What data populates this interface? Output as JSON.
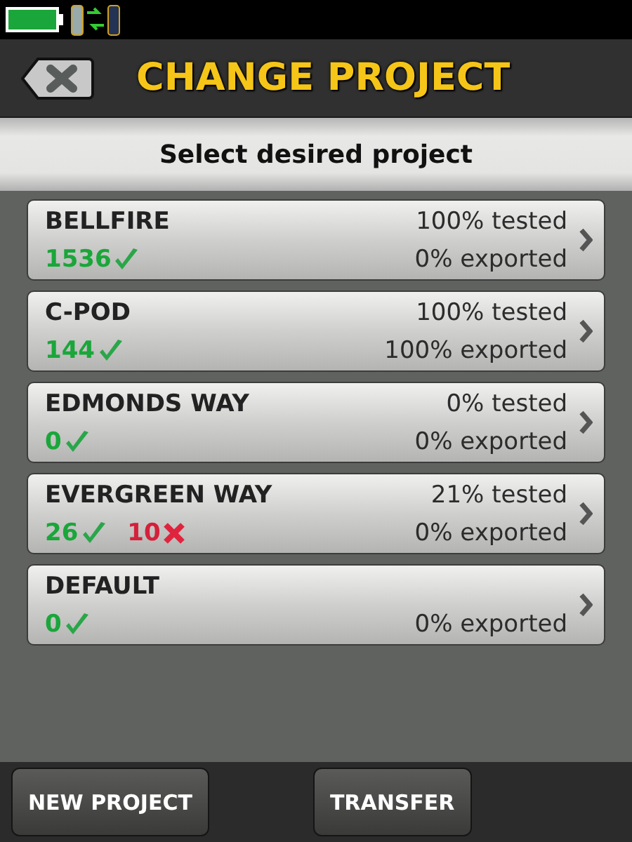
{
  "header": {
    "title": "CHANGE PROJECT"
  },
  "subtitle": "Select desired project",
  "projects": [
    {
      "name": "BELLFIRE",
      "tested": "100% tested",
      "exported": "0% exported",
      "counts": [
        {
          "kind": "pass",
          "value": "1536"
        }
      ]
    },
    {
      "name": "C-POD",
      "tested": "100% tested",
      "exported": "100% exported",
      "counts": [
        {
          "kind": "pass",
          "value": "144"
        }
      ]
    },
    {
      "name": "EDMONDS WAY",
      "tested": "0% tested",
      "exported": "0% exported",
      "counts": [
        {
          "kind": "pass",
          "value": "0"
        }
      ]
    },
    {
      "name": "EVERGREEN WAY",
      "tested": "21% tested",
      "exported": "0% exported",
      "counts": [
        {
          "kind": "pass",
          "value": "26"
        },
        {
          "kind": "fail",
          "value": "10"
        }
      ]
    },
    {
      "name": "DEFAULT",
      "exported": "0% exported",
      "counts": [
        {
          "kind": "pass",
          "value": "0"
        }
      ]
    }
  ],
  "buttons": [
    "NEW PROJECT",
    "TRANSFER"
  ]
}
